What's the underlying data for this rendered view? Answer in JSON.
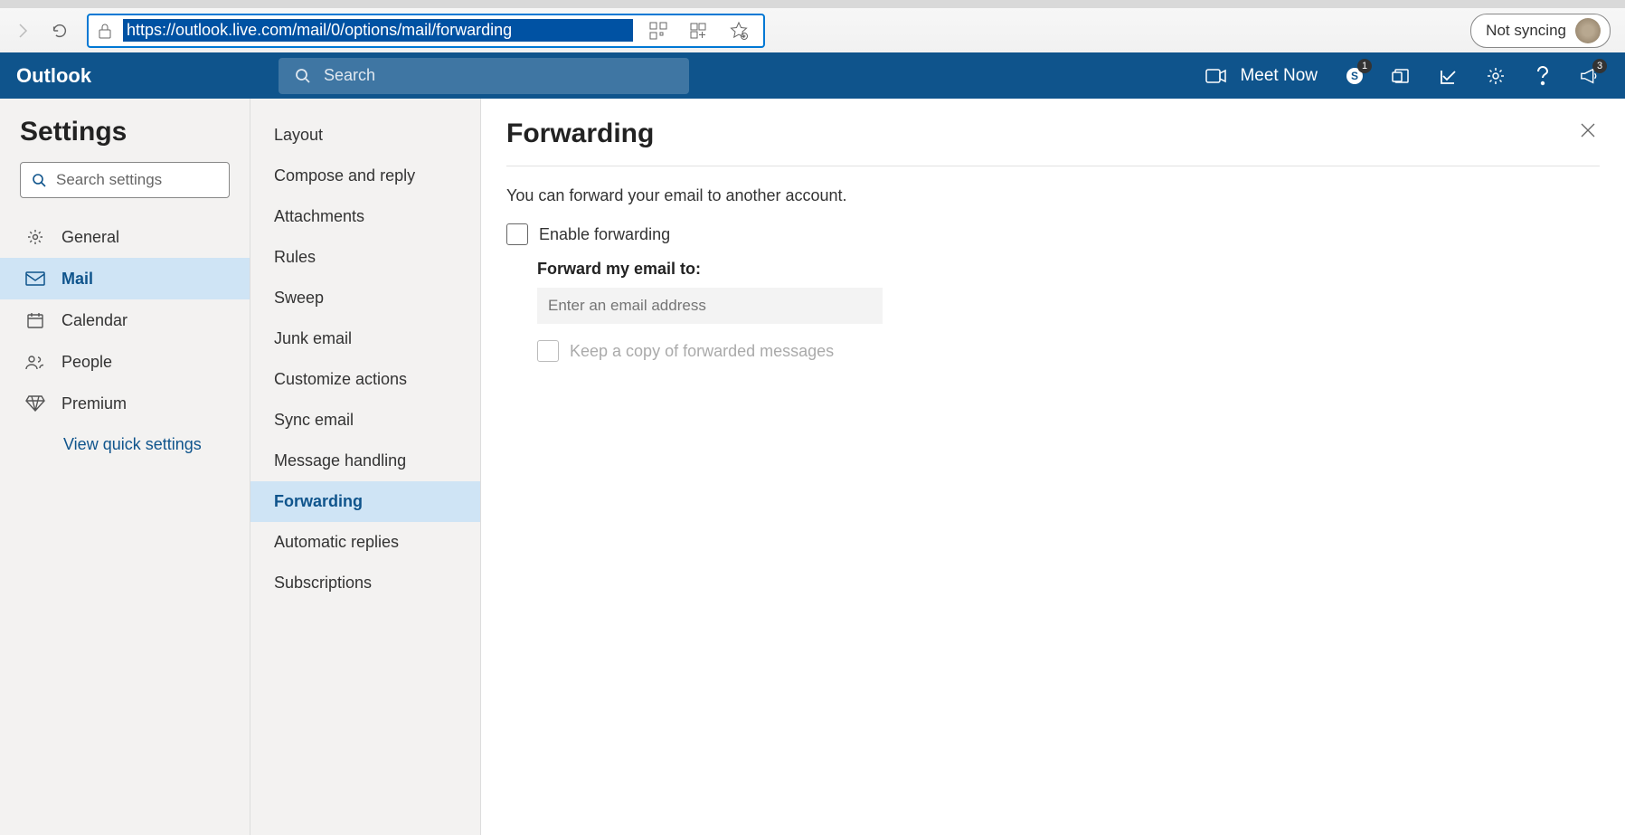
{
  "browser": {
    "url": "https://outlook.live.com/mail/0/options/mail/forwarding",
    "sync_label": "Not syncing"
  },
  "header": {
    "app_name": "Outlook",
    "search_placeholder": "Search",
    "meet_now": "Meet Now",
    "skype_badge": "1",
    "announce_badge": "3"
  },
  "sidebar": {
    "title": "Settings",
    "search_placeholder": "Search settings",
    "categories": [
      {
        "label": "General"
      },
      {
        "label": "Mail"
      },
      {
        "label": "Calendar"
      },
      {
        "label": "People"
      },
      {
        "label": "Premium"
      }
    ],
    "quick_link": "View quick settings"
  },
  "subnav": {
    "items": [
      {
        "label": "Layout"
      },
      {
        "label": "Compose and reply"
      },
      {
        "label": "Attachments"
      },
      {
        "label": "Rules"
      },
      {
        "label": "Sweep"
      },
      {
        "label": "Junk email"
      },
      {
        "label": "Customize actions"
      },
      {
        "label": "Sync email"
      },
      {
        "label": "Message handling"
      },
      {
        "label": "Forwarding"
      },
      {
        "label": "Automatic replies"
      },
      {
        "label": "Subscriptions"
      }
    ]
  },
  "detail": {
    "title": "Forwarding",
    "description": "You can forward your email to another account.",
    "enable_label": "Enable forwarding",
    "forward_to_label": "Forward my email to:",
    "email_placeholder": "Enter an email address",
    "keep_copy_label": "Keep a copy of forwarded messages"
  }
}
